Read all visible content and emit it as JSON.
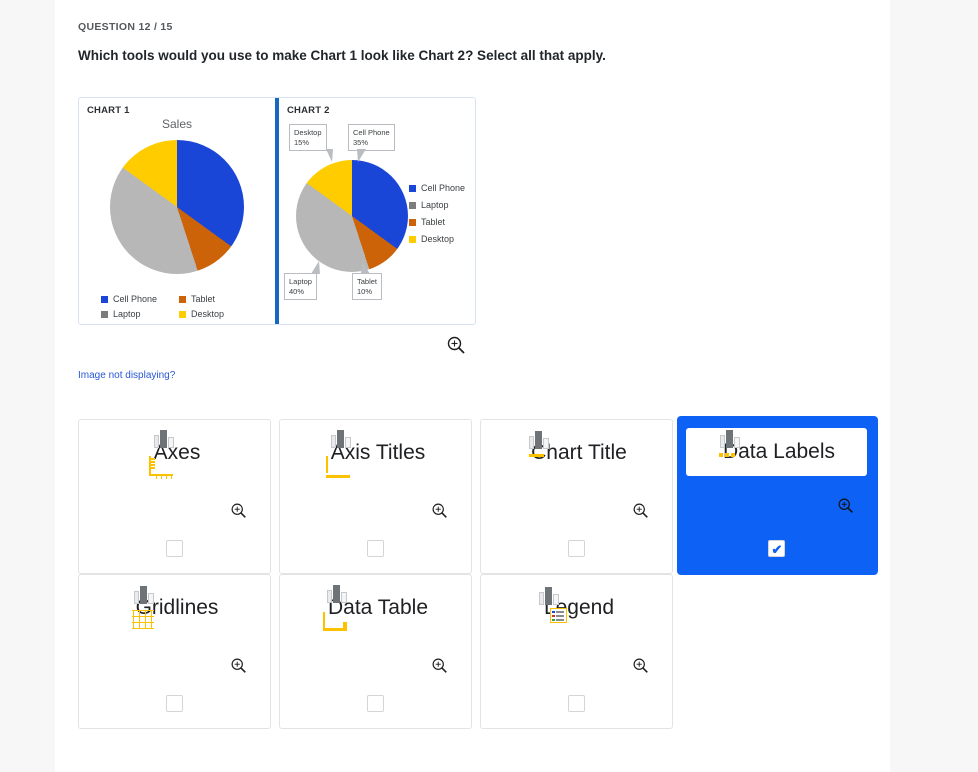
{
  "question": {
    "counter": "QUESTION 12 / 15",
    "prompt": "Which tools would you use to make Chart 1 look like Chart 2? Select all that apply."
  },
  "image_block": {
    "zoom_icon": "magnifier-zoom-in-icon",
    "fallback_link": "Image not displaying?"
  },
  "chart_data": [
    {
      "type": "pie",
      "panel_tag": "CHART 1",
      "title": "Sales",
      "categories": [
        "Cell Phone",
        "Tablet",
        "Laptop",
        "Desktop"
      ],
      "values": [
        35,
        10,
        40,
        15
      ],
      "colors": [
        "#1a46d8",
        "#cc6309",
        "#b7b7b7",
        "#ffcc00"
      ],
      "legend": {
        "position": "bottom",
        "entries": [
          {
            "label": "Cell Phone",
            "color": "#1a46d8"
          },
          {
            "label": "Tablet",
            "color": "#cc6309"
          },
          {
            "label": "Laptop",
            "color": "#7c7c7c"
          },
          {
            "label": "Desktop",
            "color": "#ffcc00"
          }
        ]
      },
      "data_labels": false,
      "grid": false
    },
    {
      "type": "pie",
      "panel_tag": "CHART 2",
      "title": "",
      "categories": [
        "Cell Phone",
        "Tablet",
        "Laptop",
        "Desktop"
      ],
      "values": [
        35,
        10,
        40,
        15
      ],
      "colors": [
        "#1a46d8",
        "#cc6309",
        "#b7b7b7",
        "#ffcc00"
      ],
      "legend": {
        "position": "right",
        "entries": [
          {
            "label": "Cell Phone",
            "color": "#1a46d8"
          },
          {
            "label": "Laptop",
            "color": "#7c7c7c"
          },
          {
            "label": "Tablet",
            "color": "#cc6309"
          },
          {
            "label": "Desktop",
            "color": "#ffcc00"
          }
        ]
      },
      "data_labels": true,
      "labels": [
        {
          "name": "Cell Phone",
          "pct": "35%",
          "text_line1": "Cell Phone",
          "text_line2": "35%"
        },
        {
          "name": "Desktop",
          "pct": "15%",
          "text_line1": "Desktop",
          "text_line2": "15%"
        },
        {
          "name": "Laptop",
          "pct": "40%",
          "text_line1": "Laptop",
          "text_line2": "40%"
        },
        {
          "name": "Tablet",
          "pct": "10%",
          "text_line1": "Tablet",
          "text_line2": "10%"
        }
      ],
      "grid": false
    }
  ],
  "options": [
    {
      "id": "axes",
      "label": "Axes",
      "icon": "chart-axes-icon",
      "checked": false,
      "zoom_icon": "magnifier-zoom-in-icon"
    },
    {
      "id": "axis-titles",
      "label": "Axis Titles",
      "icon": "chart-axis-titles-icon",
      "checked": false,
      "zoom_icon": "magnifier-zoom-in-icon"
    },
    {
      "id": "chart-title",
      "label": "Chart Title",
      "icon": "chart-title-icon",
      "checked": false,
      "zoom_icon": "magnifier-zoom-in-icon"
    },
    {
      "id": "data-labels",
      "label": "Data Labels",
      "icon": "chart-data-labels-icon",
      "checked": true,
      "zoom_icon": "magnifier-zoom-in-icon"
    },
    {
      "id": "gridlines",
      "label": "Gridlines",
      "icon": "chart-gridlines-icon",
      "checked": false,
      "zoom_icon": "magnifier-zoom-in-icon"
    },
    {
      "id": "data-table",
      "label": "Data Table",
      "icon": "chart-data-table-icon",
      "checked": false,
      "zoom_icon": "magnifier-zoom-in-icon"
    },
    {
      "id": "legend",
      "label": "Legend",
      "icon": "chart-legend-icon",
      "checked": false,
      "zoom_icon": "magnifier-zoom-in-icon"
    }
  ],
  "checkmark_glyph": "✔",
  "colors": {
    "selected_blue": "#0d62f5",
    "link_blue": "#2757d6",
    "divider_blue": "#1668c1",
    "accent_yellow": "#fcc200",
    "page_bg": "#f7f7f8",
    "panel_bg": "#ffffff"
  }
}
